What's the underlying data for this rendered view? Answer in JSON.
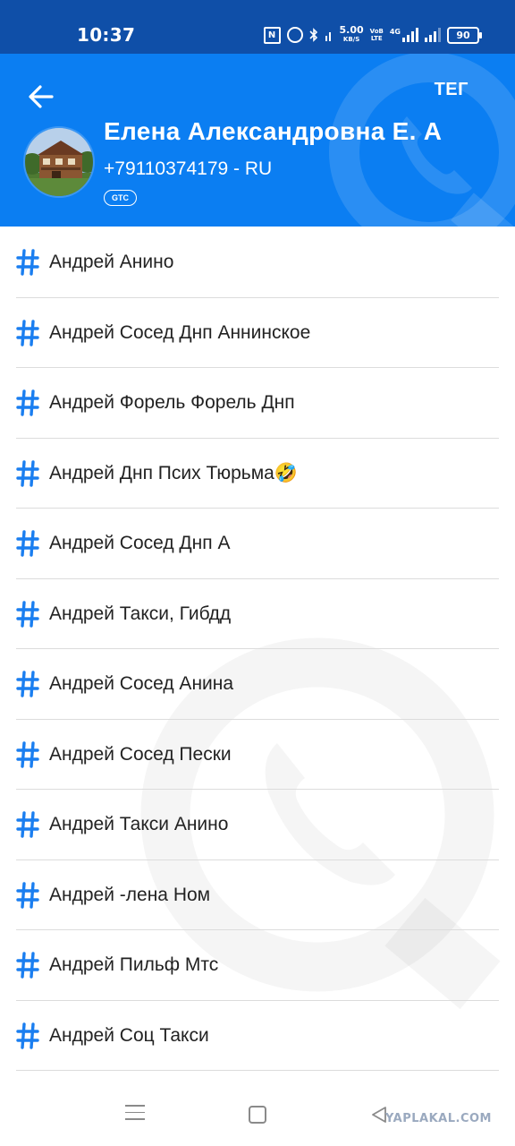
{
  "status_bar": {
    "time": "10:37",
    "nfc": "N",
    "speed_value": "5.00",
    "speed_unit": "KB/S",
    "volte_top": "VoB",
    "volte_bottom": "LTE",
    "network": "4G",
    "battery": "90"
  },
  "header": {
    "tag_button": "ТЕГ",
    "name": "Елена Александровна Е. А",
    "phone": "+79110374179 - RU",
    "operator": "GTC",
    "colors": {
      "header": "#0b7ef2",
      "status_bar": "#0f4fa8",
      "accent": "#1a7ef0"
    }
  },
  "tags": [
    "Андрей Анино",
    "Андрей Сосед Днп Аннинское",
    "Андрей Форель Форель Днп",
    "Андрей Днп Псих Тюрьма🤣",
    "Андрей Сосед Днп А",
    "Андрей Такси, Гибдд",
    "Андрей Сосед Анина",
    "Андрей Сосед Пески",
    "Андрей Такси Анино",
    "Андрей -лена Ном",
    "Андрей Пильф Мтс",
    "Андрей Соц Такси"
  ],
  "icons": {
    "back": "arrow-left-icon",
    "tag": "hashtag-icon",
    "nav_menu": "menu-icon",
    "nav_home": "home-square-icon",
    "nav_back": "triangle-back-icon"
  },
  "watermark": "YAPLAKAL.COM"
}
